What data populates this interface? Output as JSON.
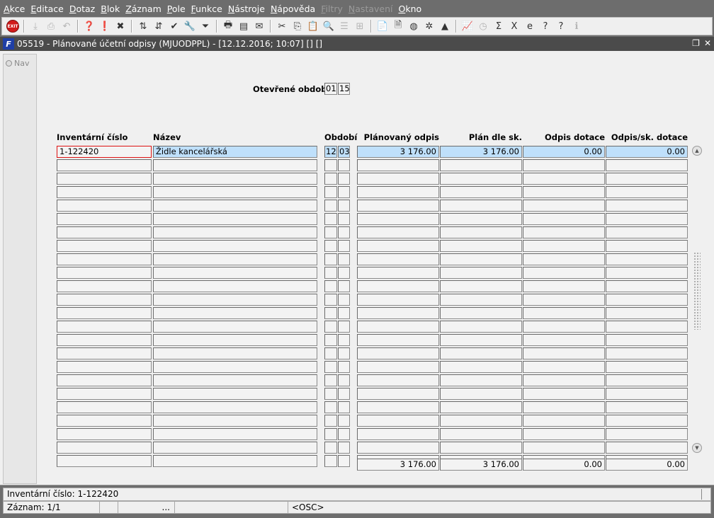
{
  "menu": [
    {
      "label": "Akce",
      "disabled": false
    },
    {
      "label": "Editace",
      "disabled": false
    },
    {
      "label": "Dotaz",
      "disabled": false
    },
    {
      "label": "Blok",
      "disabled": false
    },
    {
      "label": "Záznam",
      "disabled": false
    },
    {
      "label": "Pole",
      "disabled": false
    },
    {
      "label": "Funkce",
      "disabled": false
    },
    {
      "label": "Nástroje",
      "disabled": false
    },
    {
      "label": "Nápověda",
      "disabled": false
    },
    {
      "label": "Filtry",
      "disabled": true
    },
    {
      "label": "Nastavení",
      "disabled": true
    },
    {
      "label": "Okno",
      "disabled": false
    }
  ],
  "toolbar": {
    "exit_label": "EXIT",
    "buttons": [
      {
        "icon": "save-icon",
        "glyph": "⤓",
        "faded": true
      },
      {
        "icon": "print-preview-icon",
        "glyph": "⎙",
        "faded": true
      },
      {
        "icon": "undo-icon",
        "glyph": "↶",
        "faded": true
      },
      {
        "sep": true
      },
      {
        "icon": "enter-query-icon",
        "glyph": "❓",
        "faded": false
      },
      {
        "icon": "execute-query-icon",
        "glyph": "❗",
        "faded": false
      },
      {
        "icon": "cancel-query-icon",
        "glyph": "✖",
        "faded": false
      },
      {
        "sep": true
      },
      {
        "icon": "sort-asc-icon",
        "glyph": "⇅",
        "faded": false
      },
      {
        "icon": "sort-desc-icon",
        "glyph": "⇵",
        "faded": false
      },
      {
        "icon": "check-icon",
        "glyph": "✔",
        "faded": false
      },
      {
        "icon": "wrench-icon",
        "glyph": "🔧",
        "faded": true
      },
      {
        "icon": "filter-icon",
        "glyph": "⏷",
        "faded": false
      },
      {
        "sep": true
      },
      {
        "icon": "print-icon",
        "glyph": "🖶",
        "faded": false
      },
      {
        "icon": "report-icon",
        "glyph": "▤",
        "faded": false
      },
      {
        "icon": "mail-icon",
        "glyph": "✉",
        "faded": false
      },
      {
        "sep": true
      },
      {
        "icon": "cut-icon",
        "glyph": "✂",
        "faded": false
      },
      {
        "icon": "copy-icon",
        "glyph": "⎘",
        "faded": false
      },
      {
        "icon": "paste-icon",
        "glyph": "📋",
        "faded": true
      },
      {
        "icon": "find-icon",
        "glyph": "🔍",
        "faded": false
      },
      {
        "icon": "list-icon",
        "glyph": "☰",
        "faded": true
      },
      {
        "icon": "tree-icon",
        "glyph": "⊞",
        "faded": true
      },
      {
        "sep": true
      },
      {
        "icon": "clipboard-icon",
        "glyph": "📄",
        "faded": false
      },
      {
        "icon": "document-icon",
        "glyph": "🗎",
        "faded": false
      },
      {
        "icon": "globe-icon",
        "glyph": "◍",
        "faded": false
      },
      {
        "icon": "settings-icon",
        "glyph": "✲",
        "faded": false
      },
      {
        "icon": "warning-icon",
        "glyph": "▲",
        "faded": false
      },
      {
        "sep": true
      },
      {
        "icon": "chart-icon",
        "glyph": "📈",
        "faded": false
      },
      {
        "icon": "calc-icon",
        "glyph": "◷",
        "faded": true
      },
      {
        "icon": "sum-icon",
        "glyph": "Σ",
        "faded": false
      },
      {
        "icon": "excel-icon",
        "glyph": "X",
        "faded": false
      },
      {
        "icon": "web-icon",
        "glyph": "e",
        "faded": false
      },
      {
        "icon": "help-icon",
        "glyph": "?",
        "faded": false
      },
      {
        "icon": "context-help-icon",
        "glyph": "?",
        "faded": false
      },
      {
        "icon": "info-icon",
        "glyph": "ℹ",
        "faded": true
      }
    ]
  },
  "window": {
    "icon_letter": "F",
    "title": "05519 - Plánované účetní odpisy (MJUODPPL) - [12.12.2016; 10:07]  [] []"
  },
  "nav": {
    "label": "Nav"
  },
  "period": {
    "label": "Otevřené období",
    "month": "01",
    "year": "15"
  },
  "columns": {
    "inv": "Inventární číslo",
    "name": "Název",
    "period": "Období",
    "planned": "Plánovaný odpis",
    "plan_tax": "Plán dle sk.",
    "subsidy": "Odpis dotace",
    "subsidy_tax": "Odpis/sk. dotace"
  },
  "rows": [
    {
      "inv": "1-122420",
      "name": "Židle kancelářská",
      "p1": "12",
      "p2": "03",
      "planned": "3 176.00",
      "plan_tax": "3 176.00",
      "subsidy": "0.00",
      "subsidy_tax": "0.00"
    },
    {
      "inv": "",
      "name": "",
      "p1": "",
      "p2": "",
      "planned": "",
      "plan_tax": "",
      "subsidy": "",
      "subsidy_tax": ""
    },
    {
      "inv": "",
      "name": "",
      "p1": "",
      "p2": "",
      "planned": "",
      "plan_tax": "",
      "subsidy": "",
      "subsidy_tax": ""
    },
    {
      "inv": "",
      "name": "",
      "p1": "",
      "p2": "",
      "planned": "",
      "plan_tax": "",
      "subsidy": "",
      "subsidy_tax": ""
    },
    {
      "inv": "",
      "name": "",
      "p1": "",
      "p2": "",
      "planned": "",
      "plan_tax": "",
      "subsidy": "",
      "subsidy_tax": ""
    },
    {
      "inv": "",
      "name": "",
      "p1": "",
      "p2": "",
      "planned": "",
      "plan_tax": "",
      "subsidy": "",
      "subsidy_tax": ""
    },
    {
      "inv": "",
      "name": "",
      "p1": "",
      "p2": "",
      "planned": "",
      "plan_tax": "",
      "subsidy": "",
      "subsidy_tax": ""
    },
    {
      "inv": "",
      "name": "",
      "p1": "",
      "p2": "",
      "planned": "",
      "plan_tax": "",
      "subsidy": "",
      "subsidy_tax": ""
    },
    {
      "inv": "",
      "name": "",
      "p1": "",
      "p2": "",
      "planned": "",
      "plan_tax": "",
      "subsidy": "",
      "subsidy_tax": ""
    },
    {
      "inv": "",
      "name": "",
      "p1": "",
      "p2": "",
      "planned": "",
      "plan_tax": "",
      "subsidy": "",
      "subsidy_tax": ""
    },
    {
      "inv": "",
      "name": "",
      "p1": "",
      "p2": "",
      "planned": "",
      "plan_tax": "",
      "subsidy": "",
      "subsidy_tax": ""
    },
    {
      "inv": "",
      "name": "",
      "p1": "",
      "p2": "",
      "planned": "",
      "plan_tax": "",
      "subsidy": "",
      "subsidy_tax": ""
    },
    {
      "inv": "",
      "name": "",
      "p1": "",
      "p2": "",
      "planned": "",
      "plan_tax": "",
      "subsidy": "",
      "subsidy_tax": ""
    },
    {
      "inv": "",
      "name": "",
      "p1": "",
      "p2": "",
      "planned": "",
      "plan_tax": "",
      "subsidy": "",
      "subsidy_tax": ""
    },
    {
      "inv": "",
      "name": "",
      "p1": "",
      "p2": "",
      "planned": "",
      "plan_tax": "",
      "subsidy": "",
      "subsidy_tax": ""
    },
    {
      "inv": "",
      "name": "",
      "p1": "",
      "p2": "",
      "planned": "",
      "plan_tax": "",
      "subsidy": "",
      "subsidy_tax": ""
    },
    {
      "inv": "",
      "name": "",
      "p1": "",
      "p2": "",
      "planned": "",
      "plan_tax": "",
      "subsidy": "",
      "subsidy_tax": ""
    },
    {
      "inv": "",
      "name": "",
      "p1": "",
      "p2": "",
      "planned": "",
      "plan_tax": "",
      "subsidy": "",
      "subsidy_tax": ""
    },
    {
      "inv": "",
      "name": "",
      "p1": "",
      "p2": "",
      "planned": "",
      "plan_tax": "",
      "subsidy": "",
      "subsidy_tax": ""
    },
    {
      "inv": "",
      "name": "",
      "p1": "",
      "p2": "",
      "planned": "",
      "plan_tax": "",
      "subsidy": "",
      "subsidy_tax": ""
    },
    {
      "inv": "",
      "name": "",
      "p1": "",
      "p2": "",
      "planned": "",
      "plan_tax": "",
      "subsidy": "",
      "subsidy_tax": ""
    },
    {
      "inv": "",
      "name": "",
      "p1": "",
      "p2": "",
      "planned": "",
      "plan_tax": "",
      "subsidy": "",
      "subsidy_tax": ""
    },
    {
      "inv": "",
      "name": "",
      "p1": "",
      "p2": "",
      "planned": "",
      "plan_tax": "",
      "subsidy": "",
      "subsidy_tax": ""
    },
    {
      "inv": "",
      "name": "",
      "p1": "",
      "p2": "",
      "planned": "",
      "plan_tax": "",
      "subsidy": "",
      "subsidy_tax": ""
    }
  ],
  "totals": {
    "planned": "3 176.00",
    "plan_tax": "3 176.00",
    "subsidy": "0.00",
    "subsidy_tax": "0.00"
  },
  "status": {
    "line1": "Inventární číslo: 1-122420",
    "record": "Záznam: 1/1",
    "ellipsis": "...",
    "mode": "<OSC>"
  },
  "colors": {
    "selected_row": "#bfe0fb",
    "current_field_border": "#dd1111",
    "titlebar": "#4b4b4b"
  }
}
